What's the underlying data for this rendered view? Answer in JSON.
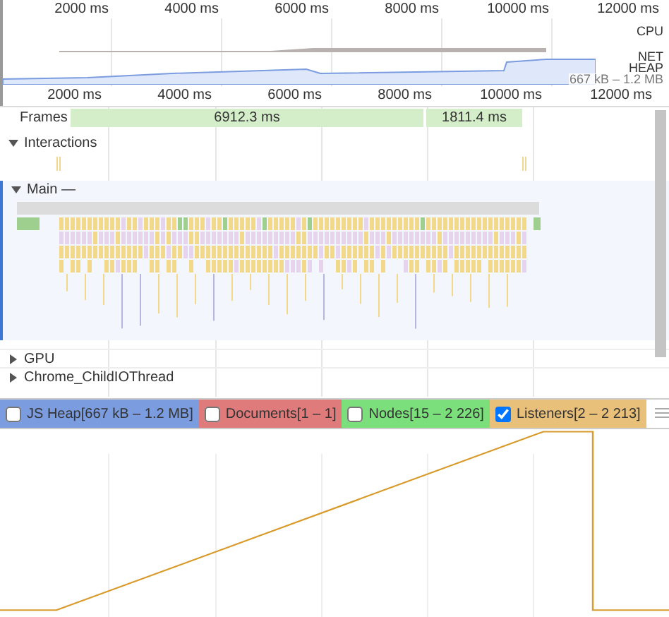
{
  "overview": {
    "ruler_ticks": [
      "2000 ms",
      "4000 ms",
      "6000 ms",
      "8000 ms",
      "10000 ms",
      "12000 ms"
    ],
    "tracks": [
      {
        "kind": "cpu",
        "label": "CPU"
      },
      {
        "kind": "heap",
        "label": "NET",
        "sublabel": "HEAP",
        "reading": "667 kB – 1.2 MB"
      }
    ]
  },
  "timeline": {
    "ruler_ticks": [
      "2000 ms",
      "4000 ms",
      "6000 ms",
      "8000 ms",
      "10000 ms",
      "12000 ms"
    ],
    "frames": {
      "label": "Frames",
      "items": [
        "6912.3 ms",
        "1811.4 ms"
      ]
    },
    "groups": [
      {
        "kind": "interactions",
        "label": "Interactions",
        "expanded": true
      },
      {
        "kind": "main",
        "label": "Main —",
        "expanded": true
      },
      {
        "kind": "thread",
        "label": "GPU",
        "expanded": false
      },
      {
        "kind": "thread",
        "label": "Chrome_ChildIOThread",
        "expanded": false
      }
    ]
  },
  "counters": [
    {
      "label": "JS Heap[667 kB – 1.2 MB]",
      "checked": false,
      "color": "#7b9de0"
    },
    {
      "label": "Documents[1 – 1]",
      "checked": false,
      "color": "#e07b7b"
    },
    {
      "label": "Nodes[15 – 2 226]",
      "checked": false,
      "color": "#7be07b"
    },
    {
      "label": "Listeners[2 – 2 213]",
      "checked": true,
      "color": "#e8c07a"
    }
  ]
}
